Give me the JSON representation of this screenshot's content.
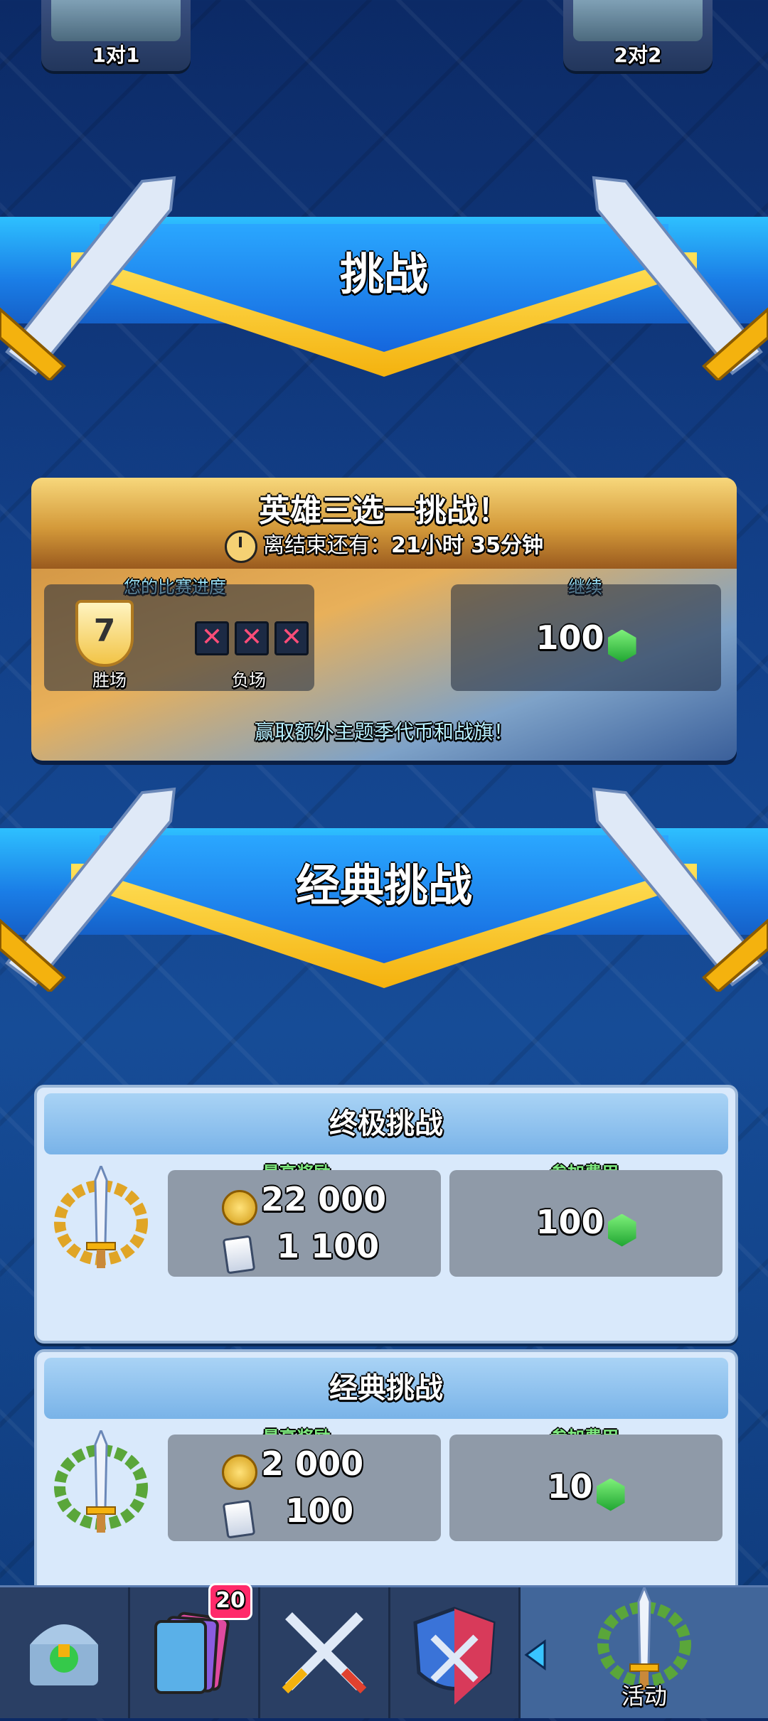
{
  "modes": {
    "mode_1v1": "1对1",
    "mode_2v2": "2对2"
  },
  "section1": {
    "title": "挑战"
  },
  "event": {
    "title": "英雄三选一挑战！",
    "timer_prefix": "离结束还有：",
    "timer_value": "21小时 35分钟",
    "progress_label": "您的比赛进度",
    "wins_value": "7",
    "wins_label": "胜场",
    "losses_label": "负场",
    "continue_label": "继续",
    "continue_cost": "100",
    "reward_text": "赢取额外主题季代币和战旗！"
  },
  "section2": {
    "title": "经典挑战"
  },
  "ultimate": {
    "title": "终极挑战",
    "reward_label": "最高奖励",
    "gold": "22 000",
    "cards": "1 100",
    "fee_label": "参加费用",
    "fee": "100"
  },
  "classic": {
    "title": "经典挑战",
    "reward_label": "最高奖励",
    "gold": "2 000",
    "cards": "100",
    "fee_label": "参加费用",
    "fee": "10"
  },
  "nav": {
    "cards_badge": "20",
    "events_label": "活动"
  },
  "colors": {
    "accent_blue": "#1a7de6",
    "gold": "#f4b20e",
    "gem_green": "#1fa531",
    "badge_pink": "#ff2a6a"
  }
}
